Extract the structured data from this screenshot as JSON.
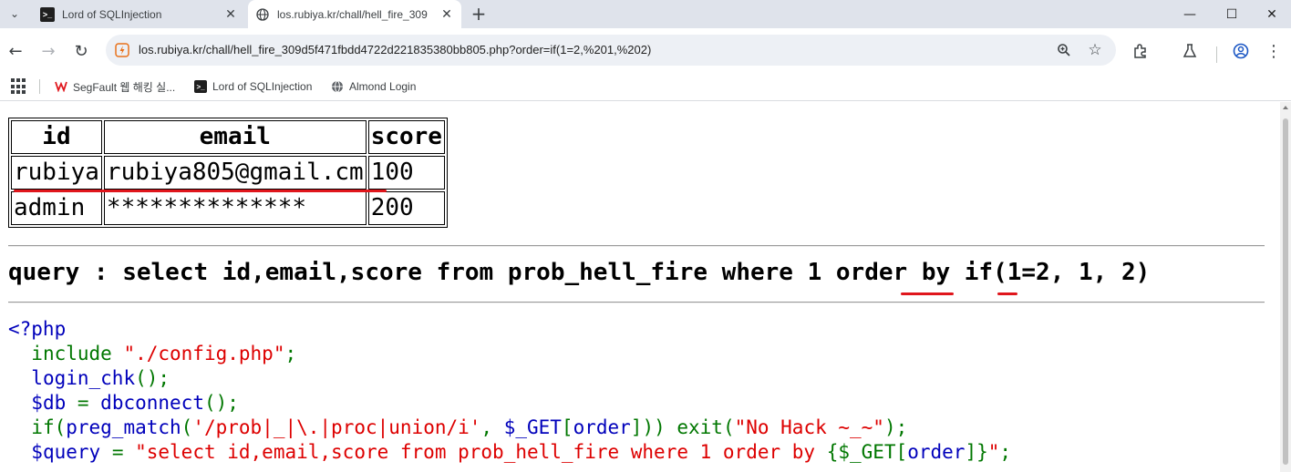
{
  "browser": {
    "tabs": [
      {
        "title": "Lord of SQLInjection",
        "active": false
      },
      {
        "title": "los.rubiya.kr/chall/hell_fire_309",
        "active": true
      }
    ],
    "url": "los.rubiya.kr/chall/hell_fire_309d5f471fbdd4722d221835380bb805.php?order=if(1=2,%201,%202)"
  },
  "bookmarks": [
    {
      "label": "SegFault 웹 해킹 실...",
      "icon": "segfault-icon"
    },
    {
      "label": "Lord of SQLInjection",
      "icon": "terminal-icon"
    },
    {
      "label": "Almond Login",
      "icon": "globe-icon"
    }
  ],
  "result_table": {
    "headers": [
      "id",
      "email",
      "score"
    ],
    "rows": [
      [
        "rubiya",
        "rubiya805@gmail.cm",
        "100"
      ],
      [
        "admin",
        "**************",
        "200"
      ]
    ]
  },
  "query": {
    "prefix": "query : select id,email,score from prob_hell_fire where 1 order by if(",
    "cond": "1=2,",
    "mid": " 1, ",
    "last": "2",
    "suffix": ")"
  },
  "code": {
    "l1": "<?php",
    "l2_fn": "include ",
    "l2_str": "\"./config.php\"",
    "l2_end": ";",
    "l3": "login_chk",
    "l3_end": "();",
    "l4_var": "$db ",
    "l4_eq": "= ",
    "l4_fn": "dbconnect",
    "l4_end": "();",
    "l5_if": "if(",
    "l5_fn": "preg_match",
    "l5_p": "(",
    "l5_str": "'/prob|_|\\.|proc|union/i'",
    "l5_c": ", ",
    "l5_var": "$_GET",
    "l5_b": "[",
    "l5_key": "order",
    "l5_rest": "])) exit(",
    "l5_msg": "\"No Hack ~_~\"",
    "l5_end": ");",
    "l6_var": "$query ",
    "l6_eq": "= ",
    "l6_str": "\"select id,email,score from prob_hell_fire where 1 order by ",
    "l6_brace": "{$_GET[",
    "l6_key": "order",
    "l6_close": "]}",
    "l6_q": "\"",
    "l6_end": ";"
  },
  "colors": {
    "annotation": "#e0161c",
    "php_keyword": "#007700",
    "php_string": "#dd0000",
    "php_default": "#0000bb"
  }
}
